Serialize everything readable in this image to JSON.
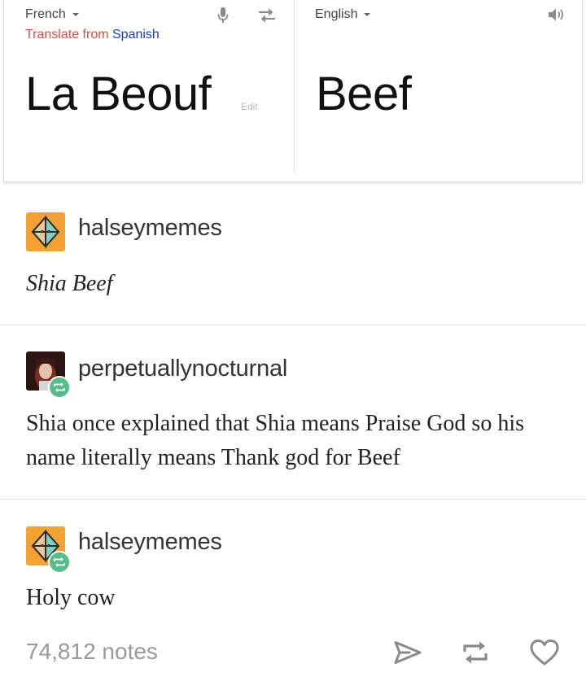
{
  "translate": {
    "source_lang": "French",
    "target_lang": "English",
    "translate_from_prefix": "Translate from",
    "translate_from_lang": "Spanish",
    "source_text": "La Beouf",
    "edit_label": "Edit",
    "target_text": "Beef",
    "icons": [
      "microphone-icon",
      "swap-icon",
      "speaker-icon",
      "chevron-down-icon"
    ]
  },
  "posts": [
    {
      "username": "halseymemes",
      "body": "Shia Beef",
      "reblog": false,
      "avatar": "geometric-avatar"
    },
    {
      "username": "perpetuallynocturnal",
      "body": "Shia once explained that Shia means Praise God so his name literally means Thank god for Beef",
      "reblog": true,
      "avatar": "photo-avatar"
    },
    {
      "username": "halseymemes",
      "body": "Holy cow",
      "reblog": true,
      "avatar": "geometric-avatar"
    }
  ],
  "footer": {
    "notes": "74,812 notes",
    "icons": [
      "share-icon",
      "reblog-icon",
      "like-icon"
    ]
  },
  "colors": {
    "reblog_green": "#56bc8a",
    "translate_from_red": "#dd4b39",
    "link_blue": "#1a3fb8",
    "avatar_orange": "#f3a233"
  }
}
